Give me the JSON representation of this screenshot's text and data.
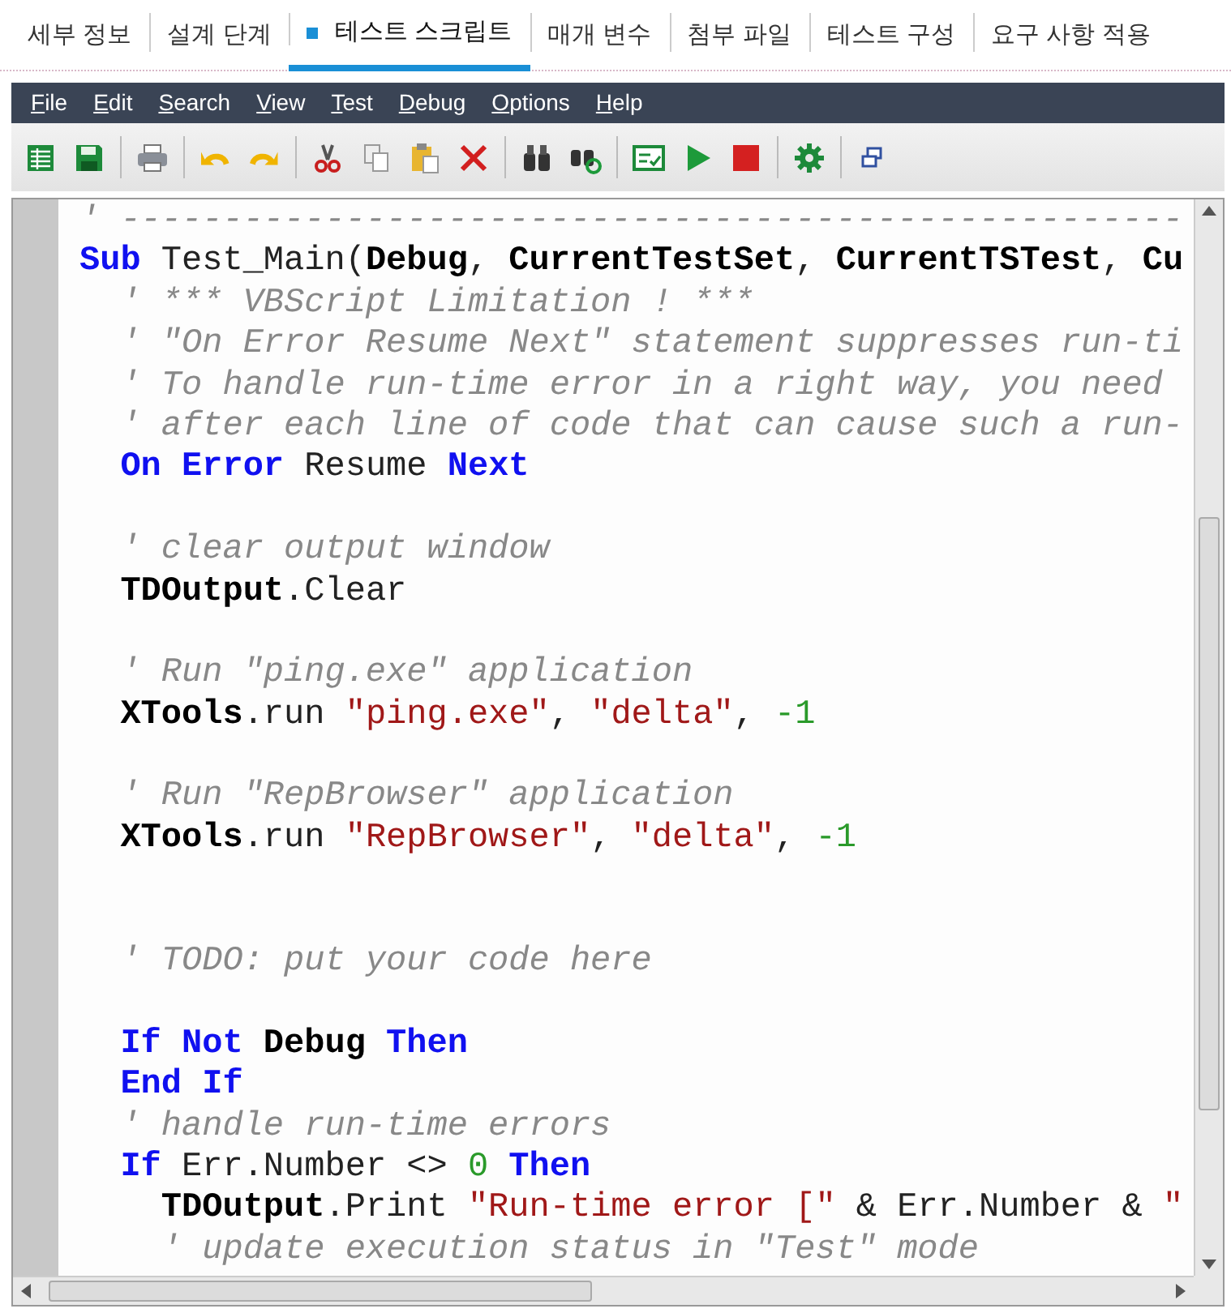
{
  "tabs": [
    {
      "label": "세부 정보",
      "selected": false
    },
    {
      "label": "설계 단계",
      "selected": false
    },
    {
      "label": "테스트 스크립트",
      "selected": true
    },
    {
      "label": "매개 변수",
      "selected": false
    },
    {
      "label": "첨부 파일",
      "selected": false
    },
    {
      "label": "테스트 구성",
      "selected": false
    },
    {
      "label": "요구 사항 적용",
      "selected": false
    }
  ],
  "menu": [
    "File",
    "Edit",
    "Search",
    "View",
    "Test",
    "Debug",
    "Options",
    "Help"
  ],
  "toolbar": [
    {
      "kind": "grid"
    },
    {
      "kind": "save"
    },
    {
      "kind": "sep"
    },
    {
      "kind": "print"
    },
    {
      "kind": "sep"
    },
    {
      "kind": "undo"
    },
    {
      "kind": "redo"
    },
    {
      "kind": "sep"
    },
    {
      "kind": "cut"
    },
    {
      "kind": "copy"
    },
    {
      "kind": "paste"
    },
    {
      "kind": "delete"
    },
    {
      "kind": "sep"
    },
    {
      "kind": "find"
    },
    {
      "kind": "replace"
    },
    {
      "kind": "sep"
    },
    {
      "kind": "check"
    },
    {
      "kind": "run"
    },
    {
      "kind": "stop"
    },
    {
      "kind": "sep"
    },
    {
      "kind": "gear"
    },
    {
      "kind": "sep"
    },
    {
      "kind": "window"
    }
  ],
  "code": [
    {
      "kind": "code",
      "tokens": [
        {
          "kind": "comment",
          "text": "' ----------------------------------------------------"
        }
      ]
    },
    {
      "kind": "code",
      "tokens": [
        {
          "kind": "keyword",
          "text": "Sub"
        },
        {
          "kind": "plain",
          "text": " Test_Main("
        },
        {
          "kind": "ident",
          "text": "Debug"
        },
        {
          "kind": "plain",
          "text": ", "
        },
        {
          "kind": "ident",
          "text": "CurrentTestSet"
        },
        {
          "kind": "plain",
          "text": ", "
        },
        {
          "kind": "ident",
          "text": "CurrentTSTest"
        },
        {
          "kind": "plain",
          "text": ", "
        },
        {
          "kind": "ident",
          "text": "Cu"
        }
      ]
    },
    {
      "kind": "code",
      "tokens": [
        {
          "kind": "comment",
          "text": "  ' *** VBScript Limitation ! ***"
        }
      ]
    },
    {
      "kind": "code",
      "tokens": [
        {
          "kind": "comment",
          "text": "  ' \"On Error Resume Next\" statement suppresses run-ti"
        }
      ]
    },
    {
      "kind": "code",
      "tokens": [
        {
          "kind": "comment",
          "text": "  ' To handle run-time error in a right way, you need"
        }
      ]
    },
    {
      "kind": "code",
      "tokens": [
        {
          "kind": "comment",
          "text": "  ' after each line of code that can cause such a run-"
        }
      ]
    },
    {
      "kind": "code",
      "tokens": [
        {
          "kind": "keyword",
          "text": "  On Error"
        },
        {
          "kind": "plain",
          "text": " Resume "
        },
        {
          "kind": "keyword",
          "text": "Next"
        }
      ]
    },
    {
      "kind": "blank"
    },
    {
      "kind": "code",
      "tokens": [
        {
          "kind": "comment",
          "text": "  ' clear output window"
        }
      ]
    },
    {
      "kind": "code",
      "tokens": [
        {
          "kind": "ident",
          "text": "  TDOutput"
        },
        {
          "kind": "plain",
          "text": ".Clear"
        }
      ]
    },
    {
      "kind": "blank"
    },
    {
      "kind": "code",
      "tokens": [
        {
          "kind": "comment",
          "text": "  ' Run \"ping.exe\" application"
        }
      ]
    },
    {
      "kind": "code",
      "tokens": [
        {
          "kind": "ident",
          "text": "  XTools"
        },
        {
          "kind": "plain",
          "text": ".run "
        },
        {
          "kind": "string",
          "text": "\"ping.exe\""
        },
        {
          "kind": "plain",
          "text": ", "
        },
        {
          "kind": "string",
          "text": "\"delta\""
        },
        {
          "kind": "plain",
          "text": ", "
        },
        {
          "kind": "number",
          "text": "-1"
        }
      ]
    },
    {
      "kind": "blank"
    },
    {
      "kind": "code",
      "tokens": [
        {
          "kind": "comment",
          "text": "  ' Run \"RepBrowser\" application"
        }
      ]
    },
    {
      "kind": "code",
      "tokens": [
        {
          "kind": "ident",
          "text": "  XTools"
        },
        {
          "kind": "plain",
          "text": ".run "
        },
        {
          "kind": "string",
          "text": "\"RepBrowser\""
        },
        {
          "kind": "plain",
          "text": ", "
        },
        {
          "kind": "string",
          "text": "\"delta\""
        },
        {
          "kind": "plain",
          "text": ", "
        },
        {
          "kind": "number",
          "text": "-1"
        }
      ]
    },
    {
      "kind": "blank"
    },
    {
      "kind": "blank"
    },
    {
      "kind": "code",
      "tokens": [
        {
          "kind": "comment",
          "text": "  ' TODO: put your code here"
        }
      ]
    },
    {
      "kind": "blank"
    },
    {
      "kind": "code",
      "tokens": [
        {
          "kind": "keyword",
          "text": "  If Not "
        },
        {
          "kind": "ident",
          "text": "Debug "
        },
        {
          "kind": "keyword",
          "text": "Then"
        }
      ]
    },
    {
      "kind": "code",
      "tokens": [
        {
          "kind": "keyword",
          "text": "  End If"
        }
      ]
    },
    {
      "kind": "code",
      "tokens": [
        {
          "kind": "comment",
          "text": "  ' handle run-time errors"
        }
      ]
    },
    {
      "kind": "code",
      "tokens": [
        {
          "kind": "keyword",
          "text": "  If"
        },
        {
          "kind": "plain",
          "text": " Err.Number <> "
        },
        {
          "kind": "number",
          "text": "0"
        },
        {
          "kind": "keyword",
          "text": " Then"
        }
      ]
    },
    {
      "kind": "code",
      "tokens": [
        {
          "kind": "ident",
          "text": "    TDOutput"
        },
        {
          "kind": "plain",
          "text": ".Print "
        },
        {
          "kind": "string",
          "text": "\"Run-time error [\""
        },
        {
          "kind": "plain",
          "text": " & Err.Number & "
        },
        {
          "kind": "string",
          "text": "\""
        }
      ]
    },
    {
      "kind": "code",
      "tokens": [
        {
          "kind": "comment",
          "text": "    ' update execution status in \"Test\" mode"
        }
      ]
    }
  ]
}
